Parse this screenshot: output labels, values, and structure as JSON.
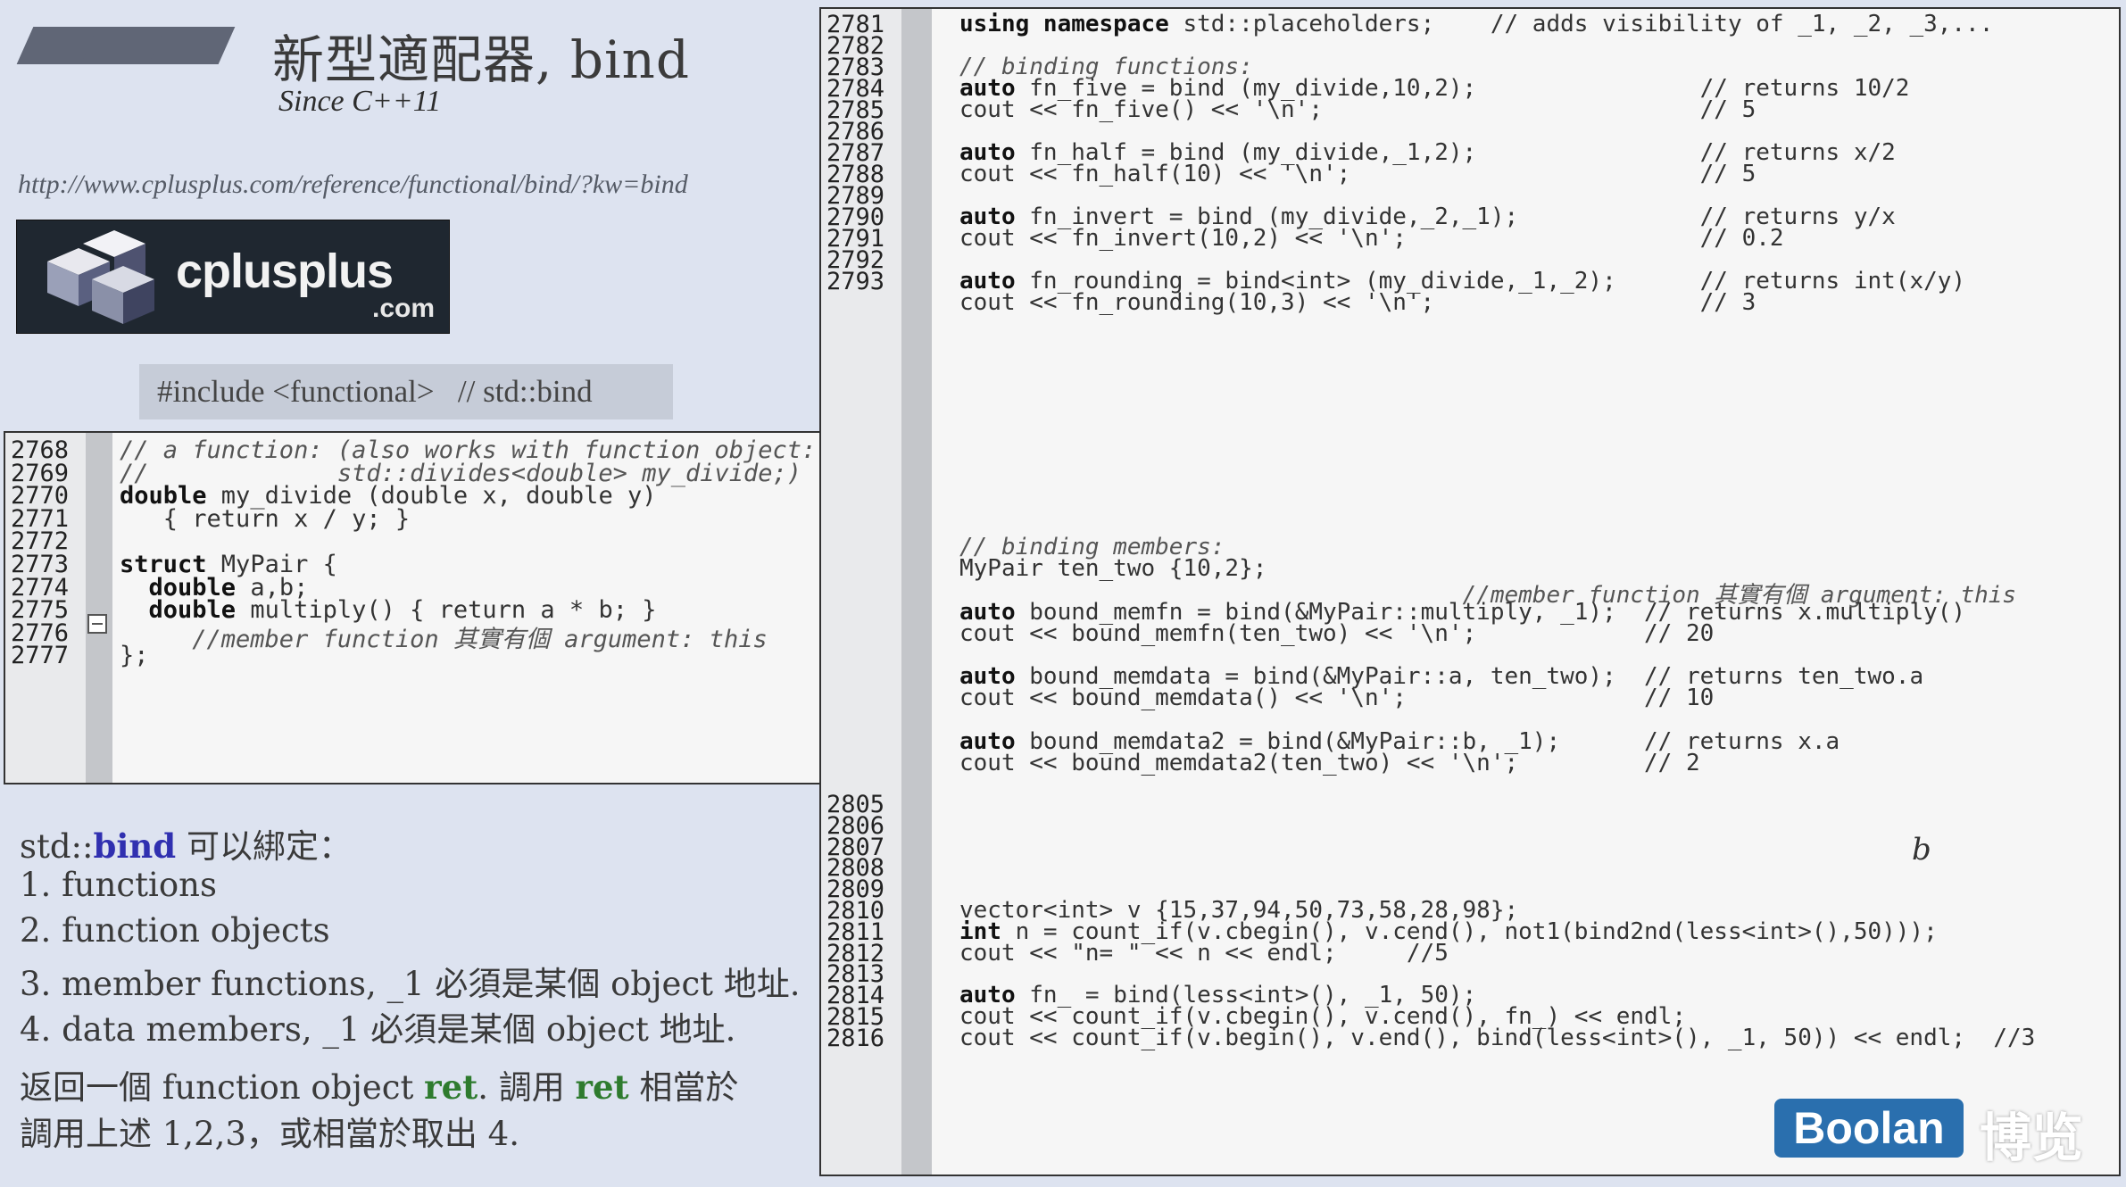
{
  "header": {
    "title": "新型適配器, bind",
    "subtitle": "Since C++11",
    "url": "http://www.cplusplus.com/reference/functional/bind/?kw=bind",
    "logo_text": "cplusplus",
    "logo_suffix": ".com",
    "include_line": "#include <functional>   // std::bind"
  },
  "left_code": {
    "lines": [
      {
        "n": "2768",
        "code": "// a function: (also works with function object:"
      },
      {
        "n": "2769",
        "code": "//             std::divides<double> my_divide;)"
      },
      {
        "n": "2770",
        "code": "double my_divide (double x, double y)"
      },
      {
        "n": "2771",
        "code": "   { return x / y; }"
      },
      {
        "n": "2772",
        "code": ""
      },
      {
        "n": "2773",
        "code": "struct MyPair {"
      },
      {
        "n": "2774",
        "code": "  double a,b;"
      },
      {
        "n": "2775",
        "code": "  double multiply() { return a * b; }"
      },
      {
        "n": "2776",
        "code": "     //member function 其實有個 argument: this"
      },
      {
        "n": "2777",
        "code": "};"
      }
    ]
  },
  "right_code_top": {
    "lines": [
      {
        "n": "2781",
        "code": "using namespace std::placeholders;    // adds visibility of _1, _2, _3,..."
      },
      {
        "n": "2782",
        "code": ""
      },
      {
        "n": "2783",
        "code": "// binding functions:"
      },
      {
        "n": "2784",
        "code": "auto fn_five = bind (my_divide,10,2);                // returns 10/2"
      },
      {
        "n": "2785",
        "code": "cout << fn_five() << '\\n';                           // 5"
      },
      {
        "n": "2786",
        "code": ""
      },
      {
        "n": "2787",
        "code": "auto fn_half = bind (my_divide,_1,2);                // returns x/2"
      },
      {
        "n": "2788",
        "code": "cout << fn_half(10) << '\\n';                         // 5"
      },
      {
        "n": "2789",
        "code": ""
      },
      {
        "n": "2790",
        "code": "auto fn_invert = bind (my_divide,_2,_1);             // returns y/x"
      },
      {
        "n": "2791",
        "code": "cout << fn_invert(10,2) << '\\n';                     // 0.2"
      },
      {
        "n": "2792",
        "code": ""
      },
      {
        "n": "2793",
        "code": "auto fn_rounding = bind<int> (my_divide,_1,_2);      // returns int(x/y)"
      },
      {
        "n": "",
        "code": "cout << fn_rounding(10,3) << '\\n';                   // 3"
      }
    ]
  },
  "right_code_mid": {
    "lines": [
      {
        "code": "// binding members:"
      },
      {
        "code": "MyPair ten_two {10,2};"
      },
      {
        "code": "                                    //member function 其實有個 argument: this"
      },
      {
        "code": "auto bound_memfn = bind(&MyPair::multiply, _1);  // returns x.multiply()"
      },
      {
        "code": "cout << bound_memfn(ten_two) << '\\n';            // 20"
      },
      {
        "code": ""
      },
      {
        "code": "auto bound_memdata = bind(&MyPair::a, ten_two);  // returns ten_two.a"
      },
      {
        "code": "cout << bound_memdata() << '\\n';                 // 10"
      },
      {
        "code": ""
      },
      {
        "code": "auto bound_memdata2 = bind(&MyPair::b, _1);      // returns x.a"
      },
      {
        "code": "cout << bound_memdata2(ten_two) << '\\n';         // 2"
      }
    ],
    "annotation": "b"
  },
  "right_code_bottom": {
    "lines": [
      {
        "n": "2805",
        "code": ""
      },
      {
        "n": "2806",
        "code": ""
      },
      {
        "n": "2807",
        "code": ""
      },
      {
        "n": "2808",
        "code": ""
      },
      {
        "n": "2809",
        "code": ""
      },
      {
        "n": "2810",
        "code": "vector<int> v {15,37,94,50,73,58,28,98};"
      },
      {
        "n": "2811",
        "code": "int n = count_if(v.cbegin(), v.cend(), not1(bind2nd(less<int>(),50)));"
      },
      {
        "n": "2812",
        "code": "cout << \"n= \" << n << endl;     //5"
      },
      {
        "n": "2813",
        "code": ""
      },
      {
        "n": "2814",
        "code": "auto fn_ = bind(less<int>(), _1, 50);"
      },
      {
        "n": "2815",
        "code": "cout << count_if(v.cbegin(), v.cend(), fn_) << endl;"
      },
      {
        "n": "2816",
        "code": "cout << count_if(v.begin(), v.end(), bind(less<int>(), _1, 50)) << endl;  //3"
      }
    ]
  },
  "notes": {
    "heading_prefix": "std::",
    "heading_bind": "bind",
    "heading_suffix": " 可以綁定：",
    "items": [
      "1. functions",
      "2. function objects",
      "3. member functions, _1 必須是某個 object 地址.",
      "4. data members, _1 必須是某個 object 地址."
    ],
    "return_line1_a": "返回一個 function object ",
    "return_line1_ret": "ret",
    "return_line1_b": ". 調用 ",
    "return_line1_ret2": "ret",
    "return_line1_c": " 相當於",
    "return_line2": "調用上述 1,2,3，或相當於取出 4."
  },
  "watermark": {
    "brand": "Boolan",
    "brand_cjk": "博览"
  },
  "colors": {
    "background": "#dde3f0",
    "highlight_blue": "#3030b0",
    "highlight_green": "#2e7b2e",
    "watermark_blue": "#2a6fae"
  }
}
